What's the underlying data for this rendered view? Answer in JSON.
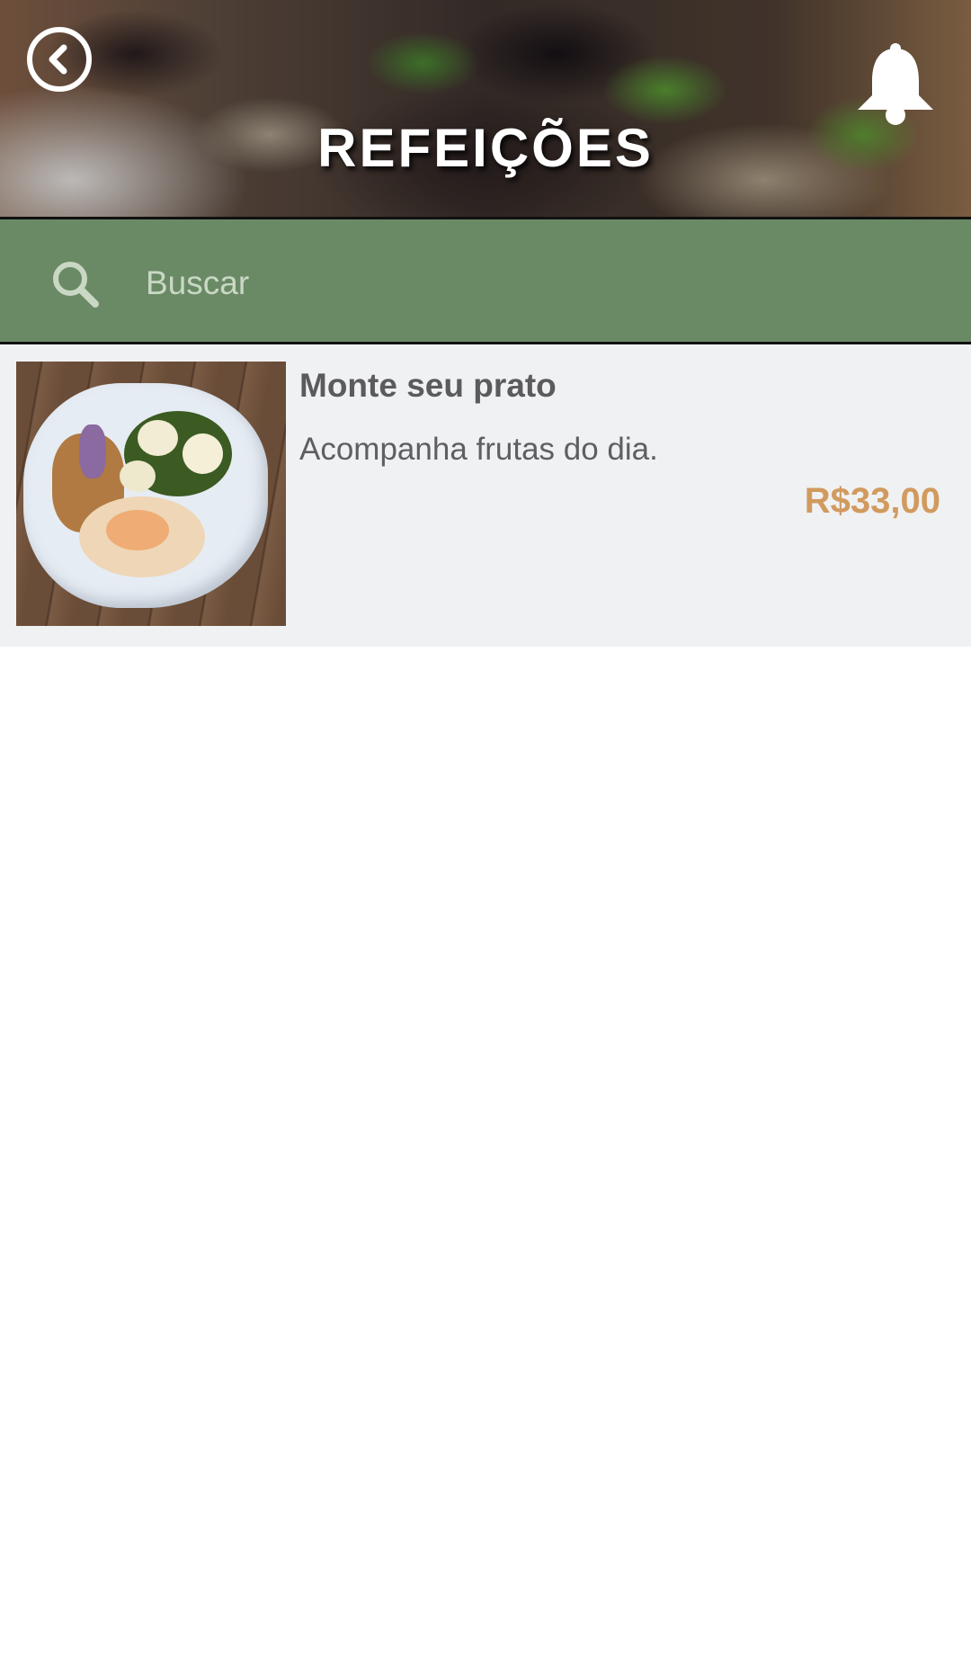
{
  "header": {
    "title": "REFEIÇÕES",
    "back_icon": "chevron-left-circle-icon",
    "notification_icon": "bell-icon"
  },
  "search": {
    "placeholder": "Buscar",
    "icon": "search-icon"
  },
  "items": [
    {
      "name": "Monte seu prato",
      "description": "Acompanha frutas do dia.",
      "price": "R$33,00"
    }
  ],
  "colors": {
    "search_bar": "#6a8a66",
    "price": "#d19a5e",
    "list_background": "#f0f1f2"
  }
}
